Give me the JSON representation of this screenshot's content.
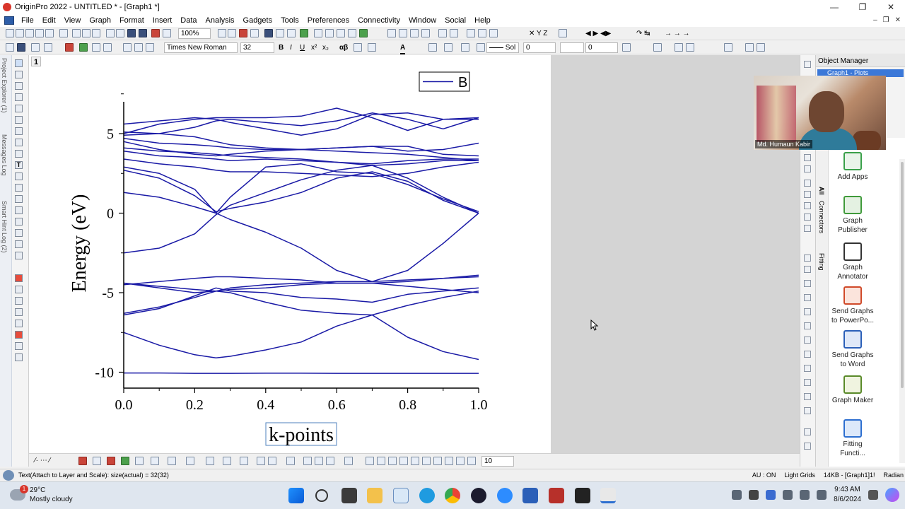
{
  "window": {
    "title": "OriginPro 2022 - UNTITLED * - [Graph1 *]",
    "controls": [
      "minimize",
      "maximize",
      "close"
    ]
  },
  "menu": [
    "File",
    "Edit",
    "View",
    "Graph",
    "Format",
    "Insert",
    "Data",
    "Analysis",
    "Gadgets",
    "Tools",
    "Preferences",
    "Connectivity",
    "Window",
    "Social",
    "Help"
  ],
  "toolbar": {
    "zoom": "100%",
    "font_name": "Times New Roman",
    "font_size": "32",
    "line_style": "Sol",
    "line_width": "0",
    "fill_value": "0",
    "bottom_size": "10"
  },
  "left_tabs": [
    "Project Explorer (1)",
    "Messages Log",
    "Smart Hint Log (2)"
  ],
  "graph": {
    "layer_number": "1",
    "legend_label": "B",
    "line_color": "#1a1aa6",
    "chart_data": {
      "type": "line",
      "title": "",
      "xlabel": "k-points",
      "ylabel": "Energy (eV)",
      "xlim": [
        0.0,
        1.0
      ],
      "ylim": [
        -11.0,
        7.0
      ],
      "x_ticks": [
        "0.0",
        "0.2",
        "0.4",
        "0.6",
        "0.8",
        "1.0"
      ],
      "y_ticks": [
        "-10",
        "-5",
        "0",
        "5"
      ],
      "x_tick_values": [
        0,
        0.2,
        0.4,
        0.6,
        0.8,
        1.0
      ],
      "y_tick_values": [
        -10,
        -5,
        0,
        5
      ],
      "legend": "top-right",
      "grid": false,
      "x": [
        0.0,
        0.1,
        0.2,
        0.26,
        0.3,
        0.4,
        0.5,
        0.6,
        0.7,
        0.8,
        0.9,
        1.0
      ],
      "series": [
        {
          "name": "B",
          "values": [
            -10.05,
            -10.05,
            -10.07,
            -10.07,
            -10.07,
            -10.06,
            -10.06,
            -10.07,
            -10.07,
            -10.07,
            -10.07,
            -10.07
          ]
        },
        {
          "name": "",
          "values": [
            -7.5,
            -8.3,
            -8.9,
            -9.1,
            -9.0,
            -8.6,
            -8.1,
            -7.1,
            -6.4,
            -7.8,
            -8.7,
            -9.2
          ]
        },
        {
          "name": "",
          "values": [
            -6.3,
            -5.9,
            -5.3,
            -4.9,
            -5.0,
            -5.6,
            -6.1,
            -6.3,
            -6.4,
            -5.8,
            -5.3,
            -4.9
          ]
        },
        {
          "name": "",
          "values": [
            -4.4,
            -4.7,
            -5.0,
            -4.9,
            -4.7,
            -4.5,
            -4.4,
            -4.3,
            -4.3,
            -4.2,
            -4.1,
            -4.0
          ]
        },
        {
          "name": "",
          "values": [
            -4.5,
            -4.3,
            -4.1,
            -4.0,
            -4.0,
            -4.1,
            -4.2,
            -4.4,
            -4.4,
            -4.3,
            -4.1,
            -3.9
          ]
        },
        {
          "name": "",
          "values": [
            -4.4,
            -4.6,
            -4.8,
            -4.9,
            -4.8,
            -4.7,
            -4.5,
            -4.4,
            -4.4,
            -4.6,
            -4.8,
            -5.0
          ]
        },
        {
          "name": "",
          "values": [
            -6.4,
            -6.0,
            -5.2,
            -4.7,
            -4.9,
            -5.0,
            -5.3,
            -5.4,
            -5.6,
            -5.1,
            -4.9,
            -4.7
          ]
        },
        {
          "name": "",
          "values": [
            -2.5,
            -2.2,
            -1.3,
            -0.1,
            0.5,
            1.3,
            2.1,
            2.7,
            3.0,
            2.2,
            1.0,
            0.0
          ]
        },
        {
          "name": "",
          "values": [
            1.3,
            1.0,
            0.4,
            0.0,
            -0.4,
            -1.2,
            -2.2,
            -3.6,
            -4.3,
            -3.6,
            -1.9,
            0.0
          ]
        },
        {
          "name": "",
          "values": [
            2.7,
            2.2,
            1.1,
            0.1,
            0.3,
            0.7,
            1.3,
            2.2,
            2.6,
            2.0,
            0.8,
            0.0
          ]
        },
        {
          "name": "",
          "values": [
            2.9,
            2.5,
            1.5,
            0.0,
            1.0,
            2.9,
            3.1,
            2.6,
            2.5,
            1.8,
            0.9,
            0.1
          ]
        },
        {
          "name": "",
          "values": [
            3.4,
            3.1,
            2.9,
            2.7,
            2.6,
            2.6,
            2.5,
            2.4,
            2.3,
            2.5,
            2.9,
            3.2
          ]
        },
        {
          "name": "",
          "values": [
            3.9,
            3.6,
            3.5,
            3.4,
            3.3,
            3.4,
            3.3,
            3.2,
            3.1,
            3.3,
            3.4,
            3.4
          ]
        },
        {
          "name": "",
          "values": [
            4.1,
            3.9,
            3.8,
            3.7,
            3.6,
            3.5,
            3.4,
            3.2,
            3.0,
            3.1,
            3.3,
            3.3
          ]
        },
        {
          "name": "",
          "values": [
            4.5,
            4.0,
            3.7,
            3.6,
            3.7,
            3.9,
            4.0,
            4.1,
            4.2,
            3.9,
            4.0,
            4.4
          ]
        },
        {
          "name": "",
          "values": [
            4.7,
            4.4,
            4.3,
            4.2,
            4.1,
            4.0,
            4.0,
            4.1,
            4.2,
            4.2,
            3.7,
            3.6
          ]
        },
        {
          "name": "",
          "values": [
            5.1,
            5.0,
            4.8,
            4.5,
            4.3,
            4.1,
            4.0,
            3.9,
            3.8,
            3.7,
            3.5,
            3.3
          ]
        },
        {
          "name": "",
          "values": [
            4.9,
            5.0,
            5.4,
            5.8,
            5.9,
            5.7,
            5.5,
            5.8,
            6.3,
            5.9,
            5.3,
            6.0
          ]
        },
        {
          "name": "",
          "values": [
            5.6,
            5.8,
            6.0,
            5.9,
            5.7,
            5.3,
            4.9,
            5.3,
            6.2,
            6.3,
            5.9,
            6.0
          ]
        },
        {
          "name": "",
          "values": [
            5.0,
            5.6,
            5.9,
            6.0,
            6.0,
            6.0,
            6.1,
            6.6,
            6.0,
            5.2,
            5.9,
            5.9
          ]
        }
      ]
    }
  },
  "object_manager": {
    "title": "Object Manager",
    "selected": "Graph1 - Plots"
  },
  "webcam_name": "Md. Humaun Kabir",
  "apps_tabs": [
    "All",
    "Connectors",
    "Fitting"
  ],
  "apps": [
    {
      "label": "Add Apps",
      "color": "#3aa04a"
    },
    {
      "label": "Graph Publisher",
      "color": "#3f9a3a"
    },
    {
      "label": "Graph Annotator",
      "color": "#333333"
    },
    {
      "label": "Send Graphs to PowerPo...",
      "color": "#d04a2a"
    },
    {
      "label": "Send Graphs to Word",
      "color": "#2b5fb8"
    },
    {
      "label": "Graph Maker",
      "color": "#5a8a2a"
    },
    {
      "label": "Fitting Functi...",
      "color": "#2d6fd0"
    }
  ],
  "status": {
    "left": "Text(Attach to Layer and Scale): size(actual) = 32(32)",
    "right": [
      "AU : ON",
      "Light Grids",
      "14KB - [Graph1]1!",
      "Radian"
    ]
  },
  "taskbar": {
    "weather_temp": "29°C",
    "weather_desc": "Mostly cloudy",
    "weather_badge": "1",
    "time": "9:43 AM",
    "date": "8/6/2024"
  }
}
